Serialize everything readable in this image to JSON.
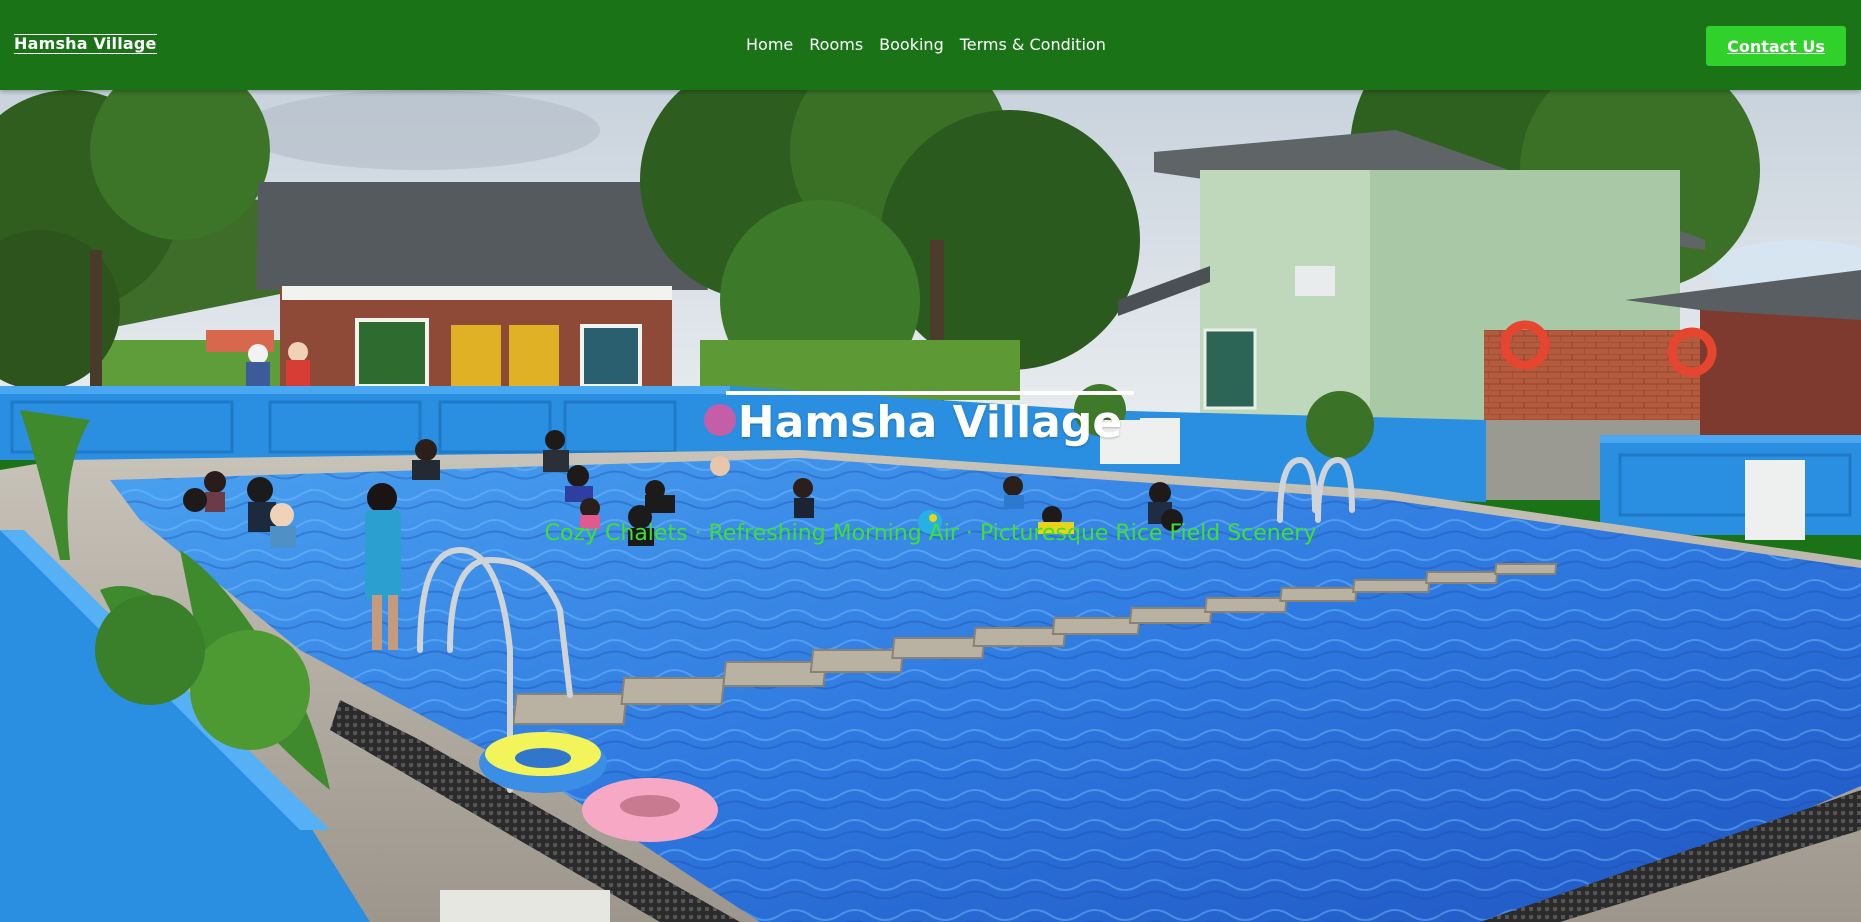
{
  "header": {
    "logo_text": "Hamsha Village",
    "nav": [
      {
        "label": "Home"
      },
      {
        "label": "Rooms"
      },
      {
        "label": "Booking"
      },
      {
        "label": "Terms & Condition"
      }
    ],
    "contact_label": "Contact Us"
  },
  "hero": {
    "title": "Hamsha Village",
    "subtitle": "Cozy Chalets · Refreshing Morning Air · Picturesque Rice Field Scenery",
    "image_alt": "swimming pool with children, chalets and trees"
  },
  "colors": {
    "header_bg": "#1b7317",
    "contact_bg": "#2fd12a",
    "subtitle": "#3ee036",
    "pool_wall": "#2a8fe0",
    "pool_water": "#2b6fd3"
  }
}
